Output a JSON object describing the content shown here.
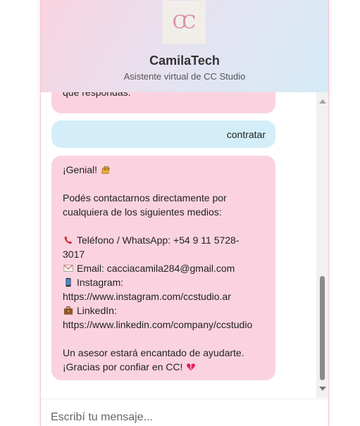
{
  "header": {
    "logo_text": "CC",
    "title": "CamilaTech",
    "subtitle": "Asistente virtual de CC Studio"
  },
  "messages": [
    {
      "sender": "bot",
      "lines": [
        "que respondas."
      ]
    },
    {
      "sender": "user",
      "lines": [
        "contratar"
      ]
    },
    {
      "sender": "bot",
      "greeting": "¡Genial!",
      "greeting_icon": "raised-hands-icon",
      "intro_lines": [
        "Podés contactarnos directamente por",
        "cualquiera de los siguientes medios:"
      ],
      "contacts": [
        {
          "icon": "telephone-icon",
          "label_lines": [
            "Teléfono / WhatsApp: +54 9 11 5728-",
            "3017"
          ]
        },
        {
          "icon": "envelope-icon",
          "label_lines": [
            "Email: cacciacamila284@gmail.com"
          ]
        },
        {
          "icon": "mobile-phone-icon",
          "label_lines": [
            "Instagram:",
            "https://www.instagram.com/ccstudio.ar"
          ]
        },
        {
          "icon": "briefcase-icon",
          "label_lines": [
            "LinkedIn:",
            "https://www.linkedin.com/company/ccstudio"
          ]
        }
      ],
      "closing_lines": [
        "Un asesor estará encantado de ayudarte.",
        "¡Gracias por confiar en CC!"
      ],
      "closing_icon": "heart-icon"
    }
  ],
  "composer": {
    "placeholder": "Escribí tu mensaje..."
  },
  "colors": {
    "bot_bubble": "#fbd3e0",
    "user_bubble": "#d3eef8",
    "header_start": "#f9d3e0",
    "header_end": "#d4ebf6",
    "logo_text": "#d98ea5"
  }
}
